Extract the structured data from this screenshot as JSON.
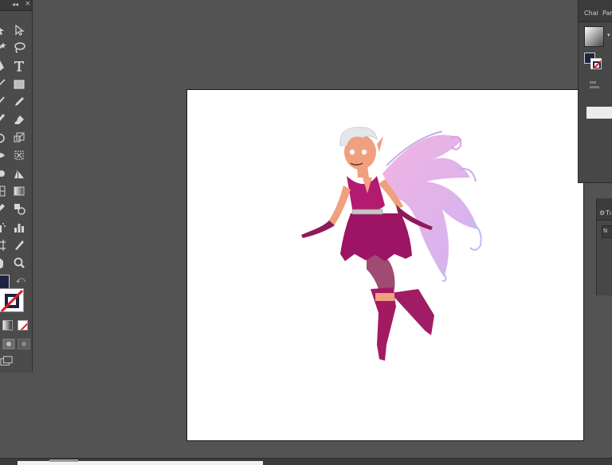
{
  "tools_panel": {
    "collapse_glyph": "◂◂",
    "close_glyph": "×",
    "icons": [
      "selection-tool-icon",
      "direct-selection-tool-icon",
      "magic-wand-tool-icon",
      "lasso-tool-icon",
      "pen-tool-icon",
      "type-tool-icon",
      "line-segment-tool-icon",
      "rectangle-tool-icon",
      "paintbrush-tool-icon",
      "pencil-tool-icon",
      "blob-brush-tool-icon",
      "eraser-tool-icon",
      "rotate-tool-icon",
      "scale-tool-icon",
      "width-tool-icon",
      "free-transform-tool-icon",
      "shape-builder-tool-icon",
      "perspective-grid-tool-icon",
      "mesh-tool-icon",
      "gradient-tool-icon",
      "eyedropper-tool-icon",
      "blend-tool-icon",
      "symbol-sprayer-tool-icon",
      "column-graph-tool-icon",
      "artboard-tool-icon",
      "slice-tool-icon",
      "hand-tool-icon",
      "zoom-tool-icon"
    ],
    "fill_color": "#1e2440",
    "stroke_color": "none",
    "swap_glyph": "⤺"
  },
  "right_panel": {
    "tabs": [
      "Chai",
      "Par"
    ],
    "swatch_gradient": "white-to-grey",
    "dropdown_glyph": "▾",
    "fill_color": "#1e2440"
  },
  "right_panel_2": {
    "gear_glyph": "⚙",
    "tab_label": "Tı",
    "field_label": "N"
  },
  "colors": {
    "workspace": "#535353",
    "panel": "#4b4b4b",
    "artboard": "#ffffff"
  }
}
